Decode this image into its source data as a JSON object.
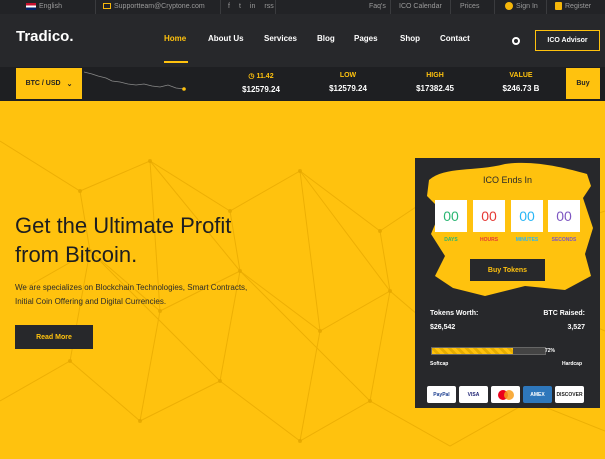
{
  "topbar": {
    "language": "English",
    "email": "Supportteam@Cryptone.com",
    "social": [
      "f",
      "t",
      "in",
      "rss"
    ],
    "links": [
      "Faq's",
      "ICO Calendar",
      "Prices"
    ],
    "sign_in": "Sign In",
    "register": "Register"
  },
  "nav": {
    "logo": "Tradico.",
    "items": [
      "Home",
      "About Us",
      "Services",
      "Blog",
      "Pages",
      "Shop",
      "Contact"
    ],
    "active": "Home",
    "advisor_button": "ICO Advisor"
  },
  "ticker": {
    "pair": "BTC / USD",
    "change_value": "11.42",
    "price": "$12579.24",
    "low_label": "LOW",
    "low_value": "$12579.24",
    "high_label": "HIGH",
    "high_value": "$17382.45",
    "value_label": "VALUE",
    "value_value": "$246.73 B",
    "buy_button": "Buy"
  },
  "hero": {
    "title_line1": "Get the Ultimate Profit",
    "title_line2": "from Bitcoin.",
    "desc_line1": "We are specializes on Blockchain Technologies, Smart Contracts,",
    "desc_line2": "Initial Coin Offering and Digital Currencies.",
    "read_more": "Read More"
  },
  "ico": {
    "title": "ICO Ends In",
    "countdown": [
      {
        "value": "00",
        "label": "DAYS",
        "color": "#2bb673"
      },
      {
        "value": "00",
        "label": "HOURS",
        "color": "#e53935"
      },
      {
        "value": "00",
        "label": "MINUTES",
        "color": "#29b6f6"
      },
      {
        "value": "00",
        "label": "SECONDS",
        "color": "#7e57c2"
      }
    ],
    "buy_tokens": "Buy Tokens",
    "tokens_worth_label": "Tokens Worth:",
    "tokens_worth_value": "$26,542",
    "btc_raised_label": "BTC Raised:",
    "btc_raised_value": "3,527",
    "progress_percent": 72,
    "progress_label": "72%",
    "softcap": "Softcap",
    "hardcap": "Hardcap",
    "payments": [
      "PayPal",
      "VISA",
      "MasterCard",
      "AMEX",
      "DISCOVER"
    ]
  },
  "colors": {
    "accent": "#ffc20e",
    "dark": "#27282b"
  }
}
